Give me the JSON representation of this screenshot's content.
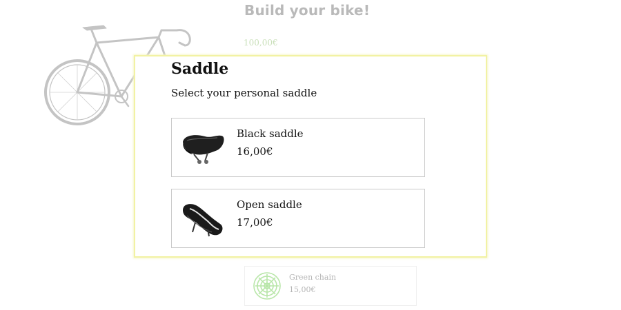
{
  "page": {
    "title": "Build your bike!",
    "total_price": "100,00€"
  },
  "background_card": {
    "name": "Green chain",
    "price": "15,00€",
    "icon": "chain-image"
  },
  "modal": {
    "title": "Saddle",
    "subtitle": "Select your personal saddle",
    "options": [
      {
        "name": "Black saddle",
        "price": "16,00€",
        "icon": "black-saddle-image"
      },
      {
        "name": "Open saddle",
        "price": "17,00€",
        "icon": "open-saddle-image"
      }
    ]
  },
  "colors": {
    "modal_border": "#f2f2a3",
    "faded_text": "#b9b9b9",
    "faded_price": "#c9dfb9",
    "chain_green": "#b8e6a8"
  }
}
